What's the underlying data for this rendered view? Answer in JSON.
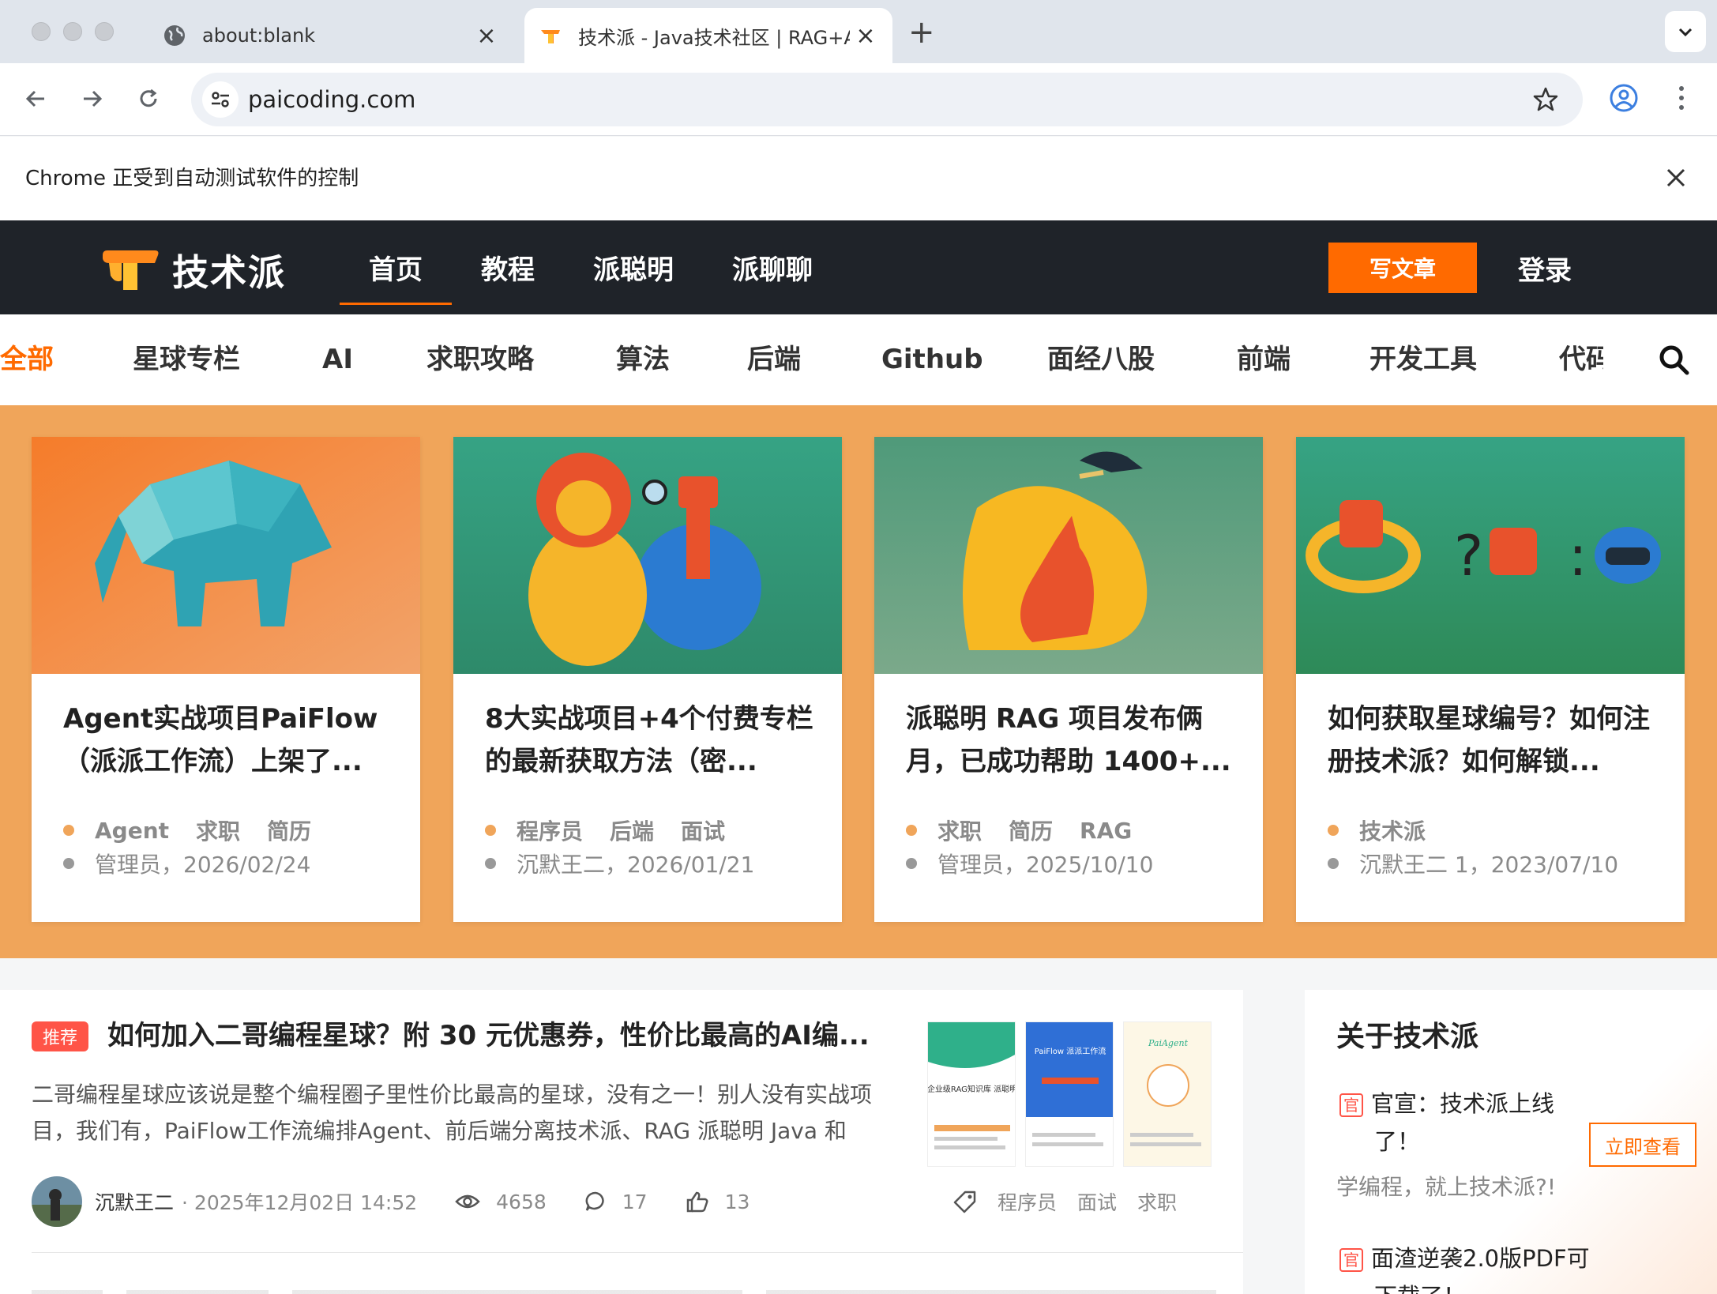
{
  "browser": {
    "tabs": [
      {
        "title": "about:blank"
      },
      {
        "title": "技术派 - Java技术社区 | RAG+AI"
      }
    ],
    "url": "paicoding.com",
    "infobar_message": "Chrome 正受到自动测试软件的控制"
  },
  "site": {
    "logo_text": "技术派",
    "nav": [
      "首页",
      "教程",
      "派聪明",
      "派聊聊"
    ],
    "write_label": "写文章",
    "login_label": "登录",
    "accent": "#ff6a00"
  },
  "categories": [
    "全部",
    "星球专栏",
    "AI",
    "求职攻略",
    "算法",
    "后端",
    "Github",
    "面经八股",
    "前端",
    "开发工具",
    "代码"
  ],
  "banner_cards": [
    {
      "title": "Agent实战项目PaiFlow（派派工作流）上架了...",
      "tags": [
        "Agent",
        "求职",
        "简历"
      ],
      "meta": "管理员，2026/02/24"
    },
    {
      "title": "8大实战项目+4个付费专栏的最新获取方法（密...",
      "tags": [
        "程序员",
        "后端",
        "面试"
      ],
      "meta": "沉默王二，2026/01/21"
    },
    {
      "title": "派聪明 RAG 项目发布俩月，已成功帮助 1400+...",
      "tags": [
        "求职",
        "简历",
        "RAG"
      ],
      "meta": "管理员，2025/10/10"
    },
    {
      "title": "如何获取星球编号？如何注册技术派？如何解锁...",
      "tags": [
        "技术派"
      ],
      "meta": "沉默王二 1，2023/07/10"
    }
  ],
  "article": {
    "badge": "推荐",
    "title": "如何加入二哥编程星球？附 30 元优惠券，性价比最高的AI编...",
    "summary": "二哥编程星球应该说是整个编程圈子里性价比最高的星球，没有之一！别人没有实战项目，我们有，PaiFlow工作流编排Agent、前后端分离技术派、RAG 派聪明 Java 和 Go...",
    "author": "沉默王二",
    "time": "· 2025年12月02日 14:52",
    "views": "4658",
    "comments": "17",
    "likes": "13",
    "tags": [
      "程序员",
      "面试",
      "求职"
    ],
    "thumbs": [
      {
        "label": "企业级RAG知识库 派聪明"
      },
      {
        "label": "PaiFlow 派派工作流"
      },
      {
        "label": "PaiAgent"
      }
    ]
  },
  "sidebar": {
    "title": "关于技术派",
    "notice1_badge": "官",
    "notice1_line1": "官宣：技术派上线",
    "notice1_line2": "了！",
    "view_label": "立即查看",
    "subtitle": "学编程，就上技术派?!",
    "notice2_badge": "官",
    "notice2_line1": "面渣逆袭2.0版PDF可",
    "notice2_line2": "下载了！"
  }
}
